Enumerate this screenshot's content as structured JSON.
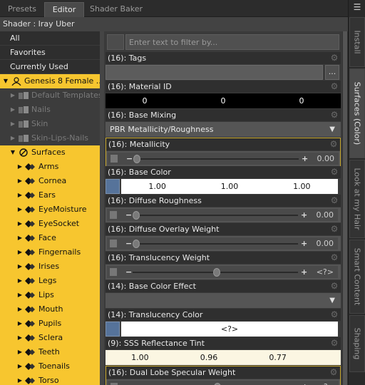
{
  "tabs": [
    "Presets",
    "Editor",
    "Shader Baker"
  ],
  "shader_label": "Shader : Iray Uber",
  "filter_placeholder": "Enter text to filter by...",
  "tree": {
    "all": "All",
    "favorites": "Favorites",
    "currently_used": "Currently Used",
    "figure": "Genesis 8 Female ...",
    "disabled_items": [
      "Default Templates",
      "Nails",
      "Skin",
      "Skin-Lips-Nails"
    ],
    "surfaces_label": "Surfaces",
    "surfaces": [
      "Arms",
      "Cornea",
      "Ears",
      "EyeMoisture",
      "EyeSocket",
      "Face",
      "Fingernails",
      "Irises",
      "Legs",
      "Lips",
      "Mouth",
      "Pupils",
      "Sclera",
      "Teeth",
      "Toenails",
      "Torso"
    ]
  },
  "properties": {
    "tags": {
      "label": "(16): Tags",
      "button": "..."
    },
    "material_id": {
      "label": "(16): Material ID",
      "values": [
        "0",
        "0",
        "0"
      ]
    },
    "base_mixing": {
      "label": "(16): Base Mixing",
      "value": "PBR Metallicity/Roughness"
    },
    "metallicity": {
      "label": "(16): Metallicity",
      "value": "0.00",
      "level": 0.0
    },
    "base_color": {
      "label": "(16): Base Color",
      "values": [
        "1.00",
        "1.00",
        "1.00"
      ],
      "swatch": "#56739a"
    },
    "diffuse_roughness": {
      "label": "(16): Diffuse Roughness",
      "value": "0.00",
      "level": 0.0
    },
    "diffuse_overlay_weight": {
      "label": "(16): Diffuse Overlay Weight",
      "value": "0.00",
      "level": 0.0
    },
    "translucency_weight": {
      "label": "(16): Translucency Weight",
      "value": "<?>",
      "level": 0.5
    },
    "base_color_effect": {
      "label": "(14): Base Color Effect",
      "value": ""
    },
    "translucency_color": {
      "label": "(14): Translucency Color",
      "value": "<?>",
      "swatch": "#56739a"
    },
    "sss_reflectance_tint": {
      "label": "(9): SSS Reflectance Tint",
      "values": [
        "1.00",
        "0.96",
        "0.77"
      ]
    },
    "dual_lobe_specular_weight": {
      "label": "(16): Dual Lobe Specular Weight",
      "value": "<?>",
      "level": 0.5
    }
  },
  "side_tabs": [
    "Install",
    "Surfaces (Color)",
    "Look at my Hair",
    "Smart Content",
    "Shaping"
  ],
  "colors": {
    "tree_bg": "#f7c62f",
    "panel_bg": "#3a3a3a",
    "highlight_border": "#c9a92d"
  }
}
